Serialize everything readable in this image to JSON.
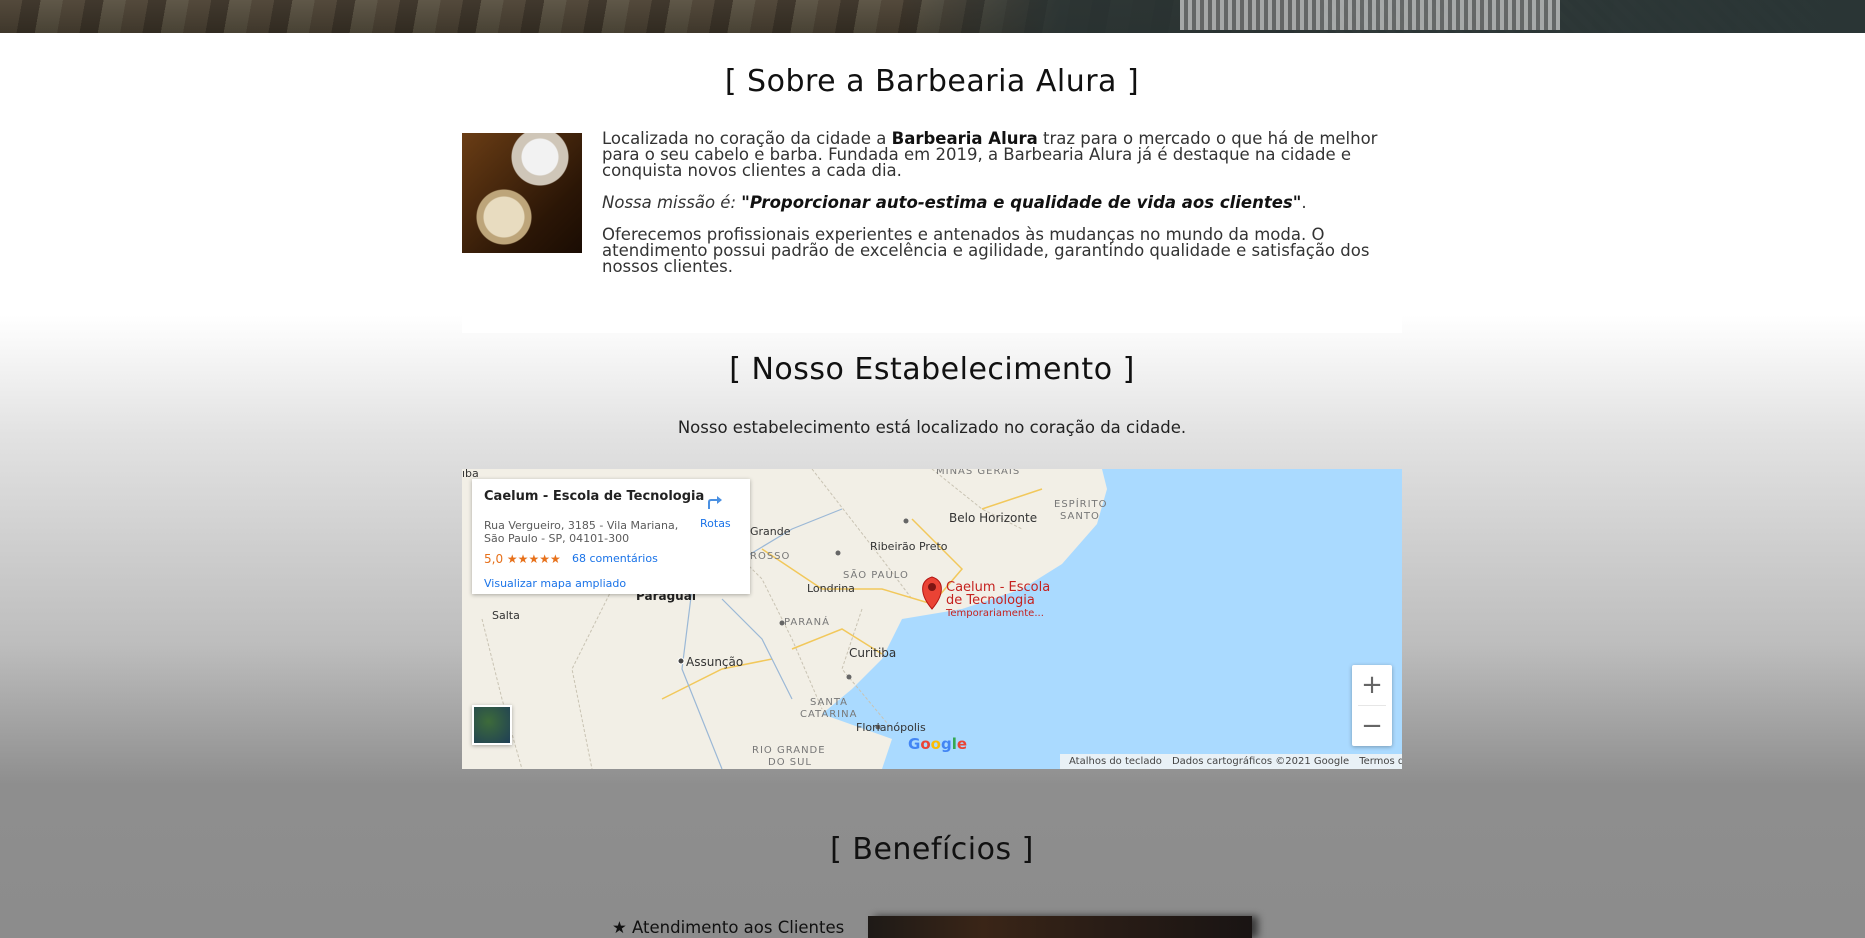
{
  "sobre": {
    "title": "[ Sobre a Barbearia Alura ]",
    "p1_a": "Localizada no coração da cidade a ",
    "p1_brand": "Barbearia Alura",
    "p1_b": " traz para o mercado o que há de melhor para o seu cabelo e barba. Fundada em 2019, a Barbearia Alura já é destaque na cidade e conquista novos clientes a cada dia.",
    "mission_label": "Nossa missão é: ",
    "mission_text": "\"Proporcionar auto-estima e qualidade de vida aos clientes\"",
    "mission_end": ".",
    "p3": "Oferecemos profissionais experientes e antenados às mudanças no mundo da moda. O atendimento possui padrão de excelência e agilidade, garantindo qualidade e satisfação dos nossos clientes."
  },
  "estabelecimento": {
    "title": "[ Nosso Estabelecimento ]",
    "description": "Nosso estabelecimento está localizado no coração da cidade."
  },
  "map": {
    "place_name": "Caelum - Escola de Tecnologia",
    "address_line1": "Rua Vergueiro, 3185 - Vila Mariana,",
    "address_line2": "São Paulo - SP, 04101-300",
    "rating": "5,0",
    "stars": "★★★★★",
    "reviews": "68 comentários",
    "expand_link": "Visualizar mapa ampliado",
    "directions": "Rotas",
    "pin_label_1": "Caelum - Escola",
    "pin_label_2": "de Tecnologia",
    "pin_label_3": "Temporariamente...",
    "labels": {
      "minas_gerais": "MINAS GERAIS",
      "espirito_santo_1": "ESPÍRITO",
      "espirito_santo_2": "SANTO",
      "belo_horizonte": "Belo Horizonte",
      "grande": "Grande",
      "ribeirao": "Ribeirão Preto",
      "rosso": "ROSSO",
      "sao_paulo": "SÃO PAULO",
      "paraguai": "Paraguai",
      "londrina": "Londrina",
      "salta": "Salta",
      "assuncao": "Assunção",
      "parana": "PARANÁ",
      "curitiba": "Curitiba",
      "santa_catarina_1": "SANTA",
      "santa_catarina_2": "CATARINA",
      "florianopolis": "Florianópolis",
      "rio_grande_1": "RIO GRANDE",
      "rio_grande_2": "DO SUL",
      "iba": "ıba"
    },
    "zoom_in": "+",
    "zoom_out": "−",
    "google": "Google",
    "attrib_keyboard": "Atalhos do teclado",
    "attrib_data": "Dados cartográficos ©2021 Google",
    "attrib_terms": "Termos de Uso",
    "colors": {
      "water": "#aadaff",
      "land": "#f2efe6",
      "pin": "#ea4335",
      "link": "#1a73e8",
      "rating": "#e7711b"
    }
  },
  "beneficios": {
    "title": "[ Benefícios ]",
    "item1": "★ Atendimento aos Clientes"
  }
}
